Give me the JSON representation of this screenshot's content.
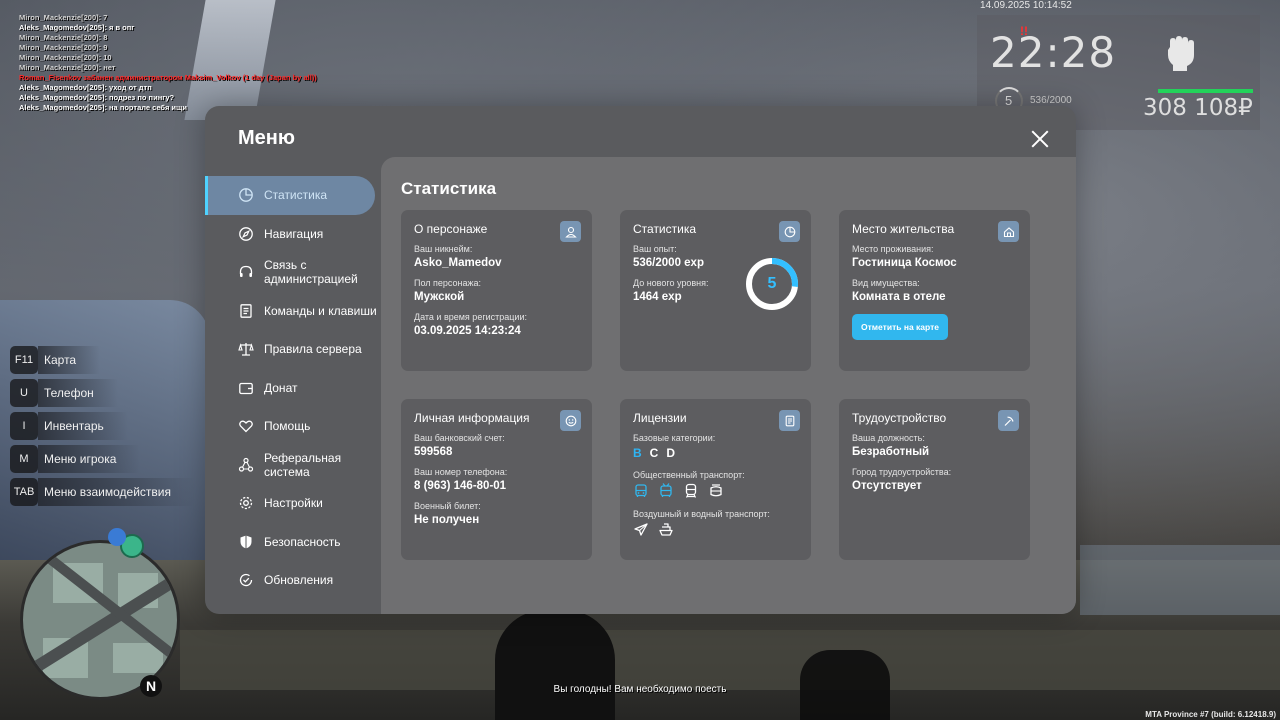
{
  "chat": [
    {
      "text": "Miron_Mackenzie[200]: 7",
      "color": "grey"
    },
    {
      "text": "Aleks_Magomedov[205]: я в опг",
      "color": "white"
    },
    {
      "text": "Miron_Mackenzie[200]: 8",
      "color": "grey"
    },
    {
      "text": "Miron_Mackenzie[200]: 9",
      "color": "grey"
    },
    {
      "text": "Miron_Mackenzie[200]: 10",
      "color": "grey"
    },
    {
      "text": "Miron_Mackenzie[200]: нет",
      "color": "grey"
    },
    {
      "text": "Roman_Fisenkov забанен администратором Maksim_Volkov (1 day (Japan by all))",
      "color": "red"
    },
    {
      "text": "Aleks_Magomedov[205]: уход от дтп",
      "color": "white"
    },
    {
      "text": "Aleks_Magomedov[205]: подрез по пингу?",
      "color": "white"
    },
    {
      "text": "Aleks_Magomedov[205]: на портале себя ищи",
      "color": "white"
    }
  ],
  "hud": {
    "date": "14.09.2025 10:14:52",
    "time": "22:28",
    "level": "5",
    "exp": "536/2000",
    "money": "308 108₽",
    "hunger_mark": "!!"
  },
  "keybinds": [
    {
      "key": "F11",
      "label": "Карта"
    },
    {
      "key": "U",
      "label": "Телефон"
    },
    {
      "key": "I",
      "label": "Инвентарь"
    },
    {
      "key": "M",
      "label": "Меню игрока"
    },
    {
      "key": "TAB",
      "label": "Меню взаимодействия"
    }
  ],
  "minimap": {
    "north": "N"
  },
  "notice": "Вы голодны! Вам необходимо поесть",
  "build": "MTA Province #7 (build: 6.12418.9)",
  "menu": {
    "title": "Меню",
    "sidebar": [
      {
        "label": "Статистика",
        "icon": "pie-chart-icon",
        "active": true
      },
      {
        "label": "Навигация",
        "icon": "compass-icon"
      },
      {
        "label": "Связь с администрацией",
        "icon": "headset-icon"
      },
      {
        "label": "Команды и клавиши",
        "icon": "document-icon"
      },
      {
        "label": "Правила сервера",
        "icon": "scales-icon"
      },
      {
        "label": "Донат",
        "icon": "wallet-icon"
      },
      {
        "label": "Помощь",
        "icon": "handshake-heart-icon"
      },
      {
        "label": "Реферальная система",
        "icon": "network-icon"
      },
      {
        "label": "Настройки",
        "icon": "gear-icon"
      },
      {
        "label": "Безопасность",
        "icon": "shield-icon"
      },
      {
        "label": "Обновления",
        "icon": "refresh-check-icon"
      }
    ],
    "content_title": "Статистика",
    "character": {
      "title": "О персонаже",
      "nick_label": "Ваш никнейм:",
      "nick": "Asko_Mamedov",
      "gender_label": "Пол персонажа:",
      "gender": "Мужской",
      "reg_label": "Дата и время регистрации:",
      "reg": "03.09.2025 14:23:24"
    },
    "stats": {
      "title": "Статистика",
      "exp_label": "Ваш опыт:",
      "exp": "536/2000 exp",
      "next_label": "До нового уровня:",
      "next": "1464 exp",
      "level": "5",
      "progress": 0.268
    },
    "residence": {
      "title": "Место жительства",
      "place_label": "Место проживания:",
      "place": "Гостиница Космос",
      "prop_label": "Вид имущества:",
      "prop": "Комната в отеле",
      "button": "Отметить на карте"
    },
    "personal": {
      "title": "Личная информация",
      "bank_label": "Ваш банковский счет:",
      "bank": "599568",
      "phone_label": "Ваш номер телефона:",
      "phone": "8 (963) 146-80-01",
      "military_label": "Военный билет:",
      "military": "Не получен"
    },
    "licenses": {
      "title": "Лицензии",
      "base_label": "Базовые категории:",
      "categories": [
        {
          "name": "B",
          "has": true
        },
        {
          "name": "C",
          "has": false
        },
        {
          "name": "D",
          "has": false
        }
      ],
      "public_label": "Общественный транспорт:",
      "public_icons": [
        {
          "icon": "bus-icon",
          "has": true
        },
        {
          "icon": "trolleybus-icon",
          "has": true
        },
        {
          "icon": "train-icon",
          "has": false
        },
        {
          "icon": "tram-icon",
          "has": false
        }
      ],
      "air_label": "Воздушный и водный транспорт:",
      "air_icons": [
        {
          "icon": "plane-icon",
          "has": false
        },
        {
          "icon": "boat-icon",
          "has": false
        }
      ]
    },
    "employment": {
      "title": "Трудоустройство",
      "position_label": "Ваша должность:",
      "position": "Безработный",
      "city_label": "Город трудоустройства:",
      "city": "Отсутствует"
    },
    "colors": {
      "accent": "#31b7ee",
      "active_item": "#6e87a3",
      "panel": "#5a5b5e"
    }
  }
}
